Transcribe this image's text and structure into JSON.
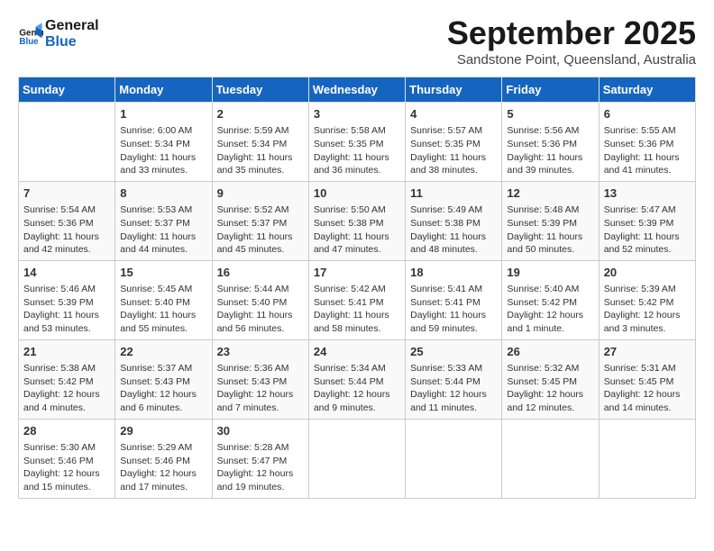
{
  "header": {
    "logo_line1": "General",
    "logo_line2": "Blue",
    "month": "September 2025",
    "location": "Sandstone Point, Queensland, Australia"
  },
  "days_of_week": [
    "Sunday",
    "Monday",
    "Tuesday",
    "Wednesday",
    "Thursday",
    "Friday",
    "Saturday"
  ],
  "weeks": [
    [
      {
        "day": "",
        "info": ""
      },
      {
        "day": "1",
        "info": "Sunrise: 6:00 AM\nSunset: 5:34 PM\nDaylight: 11 hours\nand 33 minutes."
      },
      {
        "day": "2",
        "info": "Sunrise: 5:59 AM\nSunset: 5:34 PM\nDaylight: 11 hours\nand 35 minutes."
      },
      {
        "day": "3",
        "info": "Sunrise: 5:58 AM\nSunset: 5:35 PM\nDaylight: 11 hours\nand 36 minutes."
      },
      {
        "day": "4",
        "info": "Sunrise: 5:57 AM\nSunset: 5:35 PM\nDaylight: 11 hours\nand 38 minutes."
      },
      {
        "day": "5",
        "info": "Sunrise: 5:56 AM\nSunset: 5:36 PM\nDaylight: 11 hours\nand 39 minutes."
      },
      {
        "day": "6",
        "info": "Sunrise: 5:55 AM\nSunset: 5:36 PM\nDaylight: 11 hours\nand 41 minutes."
      }
    ],
    [
      {
        "day": "7",
        "info": "Sunrise: 5:54 AM\nSunset: 5:36 PM\nDaylight: 11 hours\nand 42 minutes."
      },
      {
        "day": "8",
        "info": "Sunrise: 5:53 AM\nSunset: 5:37 PM\nDaylight: 11 hours\nand 44 minutes."
      },
      {
        "day": "9",
        "info": "Sunrise: 5:52 AM\nSunset: 5:37 PM\nDaylight: 11 hours\nand 45 minutes."
      },
      {
        "day": "10",
        "info": "Sunrise: 5:50 AM\nSunset: 5:38 PM\nDaylight: 11 hours\nand 47 minutes."
      },
      {
        "day": "11",
        "info": "Sunrise: 5:49 AM\nSunset: 5:38 PM\nDaylight: 11 hours\nand 48 minutes."
      },
      {
        "day": "12",
        "info": "Sunrise: 5:48 AM\nSunset: 5:39 PM\nDaylight: 11 hours\nand 50 minutes."
      },
      {
        "day": "13",
        "info": "Sunrise: 5:47 AM\nSunset: 5:39 PM\nDaylight: 11 hours\nand 52 minutes."
      }
    ],
    [
      {
        "day": "14",
        "info": "Sunrise: 5:46 AM\nSunset: 5:39 PM\nDaylight: 11 hours\nand 53 minutes."
      },
      {
        "day": "15",
        "info": "Sunrise: 5:45 AM\nSunset: 5:40 PM\nDaylight: 11 hours\nand 55 minutes."
      },
      {
        "day": "16",
        "info": "Sunrise: 5:44 AM\nSunset: 5:40 PM\nDaylight: 11 hours\nand 56 minutes."
      },
      {
        "day": "17",
        "info": "Sunrise: 5:42 AM\nSunset: 5:41 PM\nDaylight: 11 hours\nand 58 minutes."
      },
      {
        "day": "18",
        "info": "Sunrise: 5:41 AM\nSunset: 5:41 PM\nDaylight: 11 hours\nand 59 minutes."
      },
      {
        "day": "19",
        "info": "Sunrise: 5:40 AM\nSunset: 5:42 PM\nDaylight: 12 hours\nand 1 minute."
      },
      {
        "day": "20",
        "info": "Sunrise: 5:39 AM\nSunset: 5:42 PM\nDaylight: 12 hours\nand 3 minutes."
      }
    ],
    [
      {
        "day": "21",
        "info": "Sunrise: 5:38 AM\nSunset: 5:42 PM\nDaylight: 12 hours\nand 4 minutes."
      },
      {
        "day": "22",
        "info": "Sunrise: 5:37 AM\nSunset: 5:43 PM\nDaylight: 12 hours\nand 6 minutes."
      },
      {
        "day": "23",
        "info": "Sunrise: 5:36 AM\nSunset: 5:43 PM\nDaylight: 12 hours\nand 7 minutes."
      },
      {
        "day": "24",
        "info": "Sunrise: 5:34 AM\nSunset: 5:44 PM\nDaylight: 12 hours\nand 9 minutes."
      },
      {
        "day": "25",
        "info": "Sunrise: 5:33 AM\nSunset: 5:44 PM\nDaylight: 12 hours\nand 11 minutes."
      },
      {
        "day": "26",
        "info": "Sunrise: 5:32 AM\nSunset: 5:45 PM\nDaylight: 12 hours\nand 12 minutes."
      },
      {
        "day": "27",
        "info": "Sunrise: 5:31 AM\nSunset: 5:45 PM\nDaylight: 12 hours\nand 14 minutes."
      }
    ],
    [
      {
        "day": "28",
        "info": "Sunrise: 5:30 AM\nSunset: 5:46 PM\nDaylight: 12 hours\nand 15 minutes."
      },
      {
        "day": "29",
        "info": "Sunrise: 5:29 AM\nSunset: 5:46 PM\nDaylight: 12 hours\nand 17 minutes."
      },
      {
        "day": "30",
        "info": "Sunrise: 5:28 AM\nSunset: 5:47 PM\nDaylight: 12 hours\nand 19 minutes."
      },
      {
        "day": "",
        "info": ""
      },
      {
        "day": "",
        "info": ""
      },
      {
        "day": "",
        "info": ""
      },
      {
        "day": "",
        "info": ""
      }
    ]
  ]
}
